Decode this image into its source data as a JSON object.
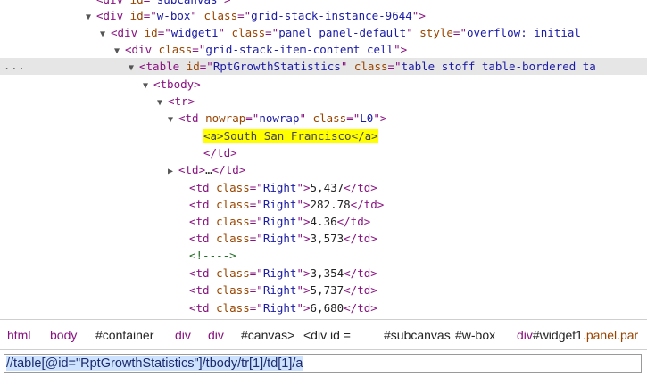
{
  "tree": {
    "selected_gutter": "...",
    "lines": [
      {
        "id": "l0",
        "segs": [
          [
            "tag",
            "<div "
          ],
          [
            "an",
            "id"
          ],
          [
            "tag",
            "=\""
          ],
          [
            "av",
            "subcanvas"
          ],
          [
            "tag",
            "\">"
          ]
        ]
      },
      {
        "id": "l1",
        "toggle": "▼",
        "segs": [
          [
            "tag",
            "<div "
          ],
          [
            "an",
            "id"
          ],
          [
            "tag",
            "=\""
          ],
          [
            "av",
            "w-box"
          ],
          [
            "tag",
            "\" "
          ],
          [
            "an",
            "class"
          ],
          [
            "tag",
            "=\""
          ],
          [
            "av",
            "grid-stack-instance-9644"
          ],
          [
            "tag",
            "\">"
          ]
        ]
      },
      {
        "id": "l2",
        "toggle": "▼",
        "segs": [
          [
            "tag",
            "<div "
          ],
          [
            "an",
            "id"
          ],
          [
            "tag",
            "=\""
          ],
          [
            "av",
            "widget1"
          ],
          [
            "tag",
            "\" "
          ],
          [
            "an",
            "class"
          ],
          [
            "tag",
            "=\""
          ],
          [
            "av",
            "panel panel-default"
          ],
          [
            "tag",
            "\" "
          ],
          [
            "an",
            "style"
          ],
          [
            "tag",
            "=\""
          ],
          [
            "av",
            "overflow: initial"
          ]
        ]
      },
      {
        "id": "l3",
        "toggle": "▼",
        "segs": [
          [
            "tag",
            "<div "
          ],
          [
            "an",
            "class"
          ],
          [
            "tag",
            "=\""
          ],
          [
            "av",
            "grid-stack-item-content cell"
          ],
          [
            "tag",
            "\">"
          ]
        ]
      },
      {
        "id": "l4",
        "toggle": "▼",
        "segs": [
          [
            "tag",
            "<table "
          ],
          [
            "an",
            "id"
          ],
          [
            "tag",
            "=\""
          ],
          [
            "av",
            "RptGrowthStatistics"
          ],
          [
            "tag",
            "\" "
          ],
          [
            "an",
            "class"
          ],
          [
            "tag",
            "=\""
          ],
          [
            "av",
            "table stoff table-bordered ta"
          ]
        ]
      },
      {
        "id": "l5",
        "toggle": "▼",
        "segs": [
          [
            "tag",
            "<tbody>"
          ]
        ]
      },
      {
        "id": "l6",
        "toggle": "▼",
        "segs": [
          [
            "tag",
            "<tr>"
          ]
        ]
      },
      {
        "id": "l7",
        "toggle": "▼",
        "segs": [
          [
            "tag",
            "<td "
          ],
          [
            "an",
            "nowrap"
          ],
          [
            "tag",
            "=\""
          ],
          [
            "av",
            "nowrap"
          ],
          [
            "tag",
            "\" "
          ],
          [
            "an",
            "class"
          ],
          [
            "tag",
            "=\""
          ],
          [
            "av",
            "L0"
          ],
          [
            "tag",
            "\">"
          ]
        ]
      },
      {
        "id": "l8",
        "segs": [
          [
            "hl",
            "<a>South San Francisco</a>"
          ]
        ]
      },
      {
        "id": "l9",
        "segs": [
          [
            "tag",
            "</td>"
          ]
        ]
      },
      {
        "id": "l10",
        "toggle": "▶",
        "segs": [
          [
            "tag",
            "<td>"
          ],
          [
            "tx",
            "…"
          ],
          [
            "tag",
            "</td>"
          ]
        ]
      },
      {
        "id": "l11",
        "segs": [
          [
            "tag",
            "<td "
          ],
          [
            "an",
            "class"
          ],
          [
            "tag",
            "=\""
          ],
          [
            "av",
            "Right"
          ],
          [
            "tag",
            "\">"
          ],
          [
            "tx",
            "5,437"
          ],
          [
            "tag",
            "</td>"
          ]
        ]
      },
      {
        "id": "l12",
        "segs": [
          [
            "tag",
            "<td "
          ],
          [
            "an",
            "class"
          ],
          [
            "tag",
            "=\""
          ],
          [
            "av",
            "Right"
          ],
          [
            "tag",
            "\">"
          ],
          [
            "tx",
            "282.78"
          ],
          [
            "tag",
            "</td>"
          ]
        ]
      },
      {
        "id": "l13",
        "segs": [
          [
            "tag",
            "<td "
          ],
          [
            "an",
            "class"
          ],
          [
            "tag",
            "=\""
          ],
          [
            "av",
            "Right"
          ],
          [
            "tag",
            "\">"
          ],
          [
            "tx",
            "4.36"
          ],
          [
            "tag",
            "</td>"
          ]
        ]
      },
      {
        "id": "l14",
        "segs": [
          [
            "tag",
            "<td "
          ],
          [
            "an",
            "class"
          ],
          [
            "tag",
            "=\""
          ],
          [
            "av",
            "Right"
          ],
          [
            "tag",
            "\">"
          ],
          [
            "tx",
            "3,573"
          ],
          [
            "tag",
            "</td>"
          ]
        ]
      },
      {
        "id": "l15",
        "segs": [
          [
            "cm",
            "<!---->"
          ]
        ]
      },
      {
        "id": "l16",
        "segs": [
          [
            "tag",
            "<td "
          ],
          [
            "an",
            "class"
          ],
          [
            "tag",
            "=\""
          ],
          [
            "av",
            "Right"
          ],
          [
            "tag",
            "\">"
          ],
          [
            "tx",
            "3,354"
          ],
          [
            "tag",
            "</td>"
          ]
        ]
      },
      {
        "id": "l17",
        "segs": [
          [
            "tag",
            "<td "
          ],
          [
            "an",
            "class"
          ],
          [
            "tag",
            "=\""
          ],
          [
            "av",
            "Right"
          ],
          [
            "tag",
            "\">"
          ],
          [
            "tx",
            "5,737"
          ],
          [
            "tag",
            "</td>"
          ]
        ]
      },
      {
        "id": "l18",
        "segs": [
          [
            "tag",
            "<td "
          ],
          [
            "an",
            "class"
          ],
          [
            "tag",
            "=\""
          ],
          [
            "av",
            "Right"
          ],
          [
            "tag",
            "\">"
          ],
          [
            "tx",
            "6,680"
          ],
          [
            "tag",
            "</td>"
          ]
        ]
      }
    ]
  },
  "breadcrumbs": [
    {
      "text": "html",
      "kind": "tag"
    },
    {
      "text": "body",
      "kind": "tag"
    },
    {
      "text": "#container",
      "kind": "id"
    },
    {
      "text": "div",
      "kind": "tag"
    },
    {
      "text": "div",
      "kind": "tag"
    },
    {
      "text": "#canvas>",
      "kind": "id"
    },
    {
      "text": "<div id =",
      "kind": "id"
    },
    {
      "text": "#subcanvas",
      "kind": "id"
    },
    {
      "text": "#w-box",
      "kind": "id"
    },
    {
      "text": "div#widget1.panel.par",
      "kind": "mixed",
      "tag": "div",
      "rest": "#widget1",
      "cls": ".panel.par"
    }
  ],
  "xpath": {
    "value": "//table[@id=\"RptGrowthStatistics\"]/tbody/tr[1]/td[1]/a"
  }
}
